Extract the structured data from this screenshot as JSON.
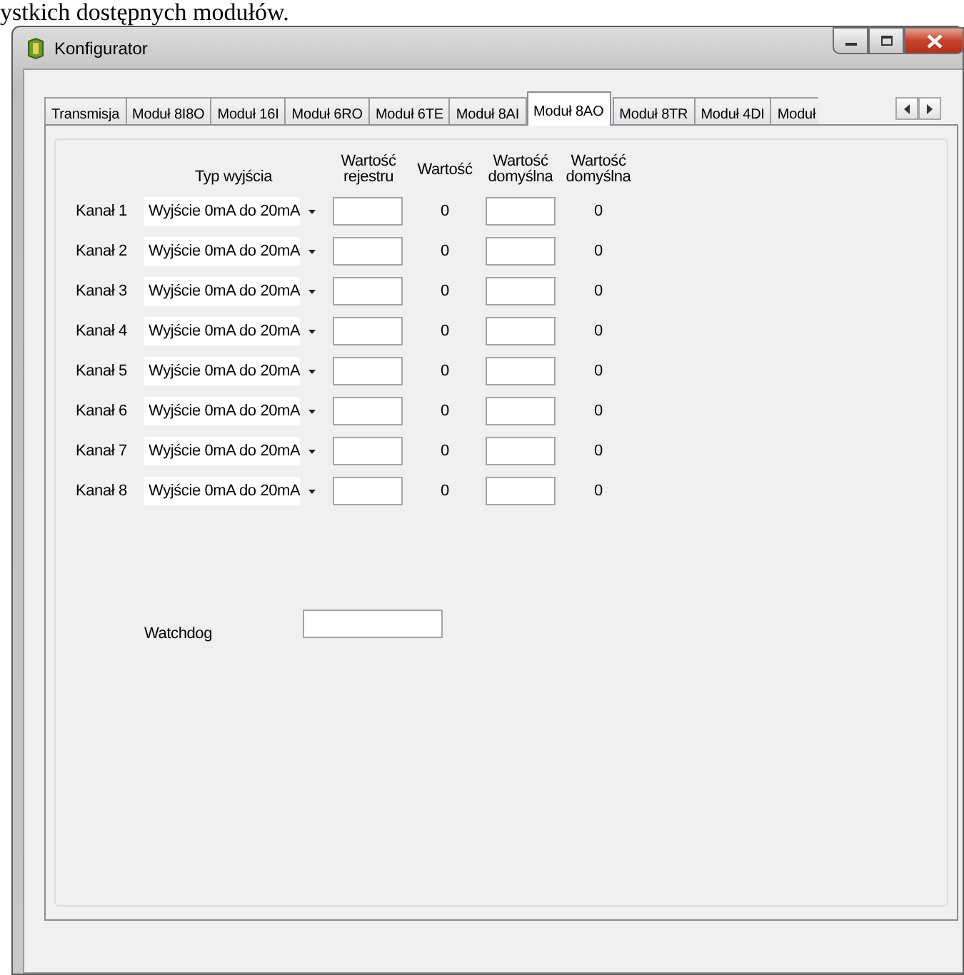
{
  "document_text": "ystkich dostępnych modułów.",
  "window": {
    "title": "Konfigurator"
  },
  "tabs": [
    {
      "label": "Transmisja",
      "selected": false
    },
    {
      "label": "Moduł 8I8O",
      "selected": false
    },
    {
      "label": "Moduł 16I",
      "selected": false
    },
    {
      "label": "Moduł 6RO",
      "selected": false
    },
    {
      "label": "Moduł 6TE",
      "selected": false
    },
    {
      "label": "Moduł 8AI",
      "selected": false
    },
    {
      "label": "Moduł 8AO",
      "selected": true
    },
    {
      "label": "Moduł 8TR",
      "selected": false
    },
    {
      "label": "Moduł 4DI",
      "selected": false
    },
    {
      "label": "Moduł",
      "selected": false
    }
  ],
  "columns": [
    "Typ wyjścia",
    "Wartość rejestru",
    "Wartość",
    "Wartość domyślna",
    "Wartość domyślna"
  ],
  "channels": [
    {
      "label": "Kanał 1",
      "output_type": "Wyjście 0mA do 20mA",
      "value": "0",
      "default_value": "0"
    },
    {
      "label": "Kanał 2",
      "output_type": "Wyjście 0mA do 20mA",
      "value": "0",
      "default_value": "0"
    },
    {
      "label": "Kanał 3",
      "output_type": "Wyjście 0mA do 20mA",
      "value": "0",
      "default_value": "0"
    },
    {
      "label": "Kanał 4",
      "output_type": "Wyjście 0mA do 20mA",
      "value": "0",
      "default_value": "0"
    },
    {
      "label": "Kanał 5",
      "output_type": "Wyjście 0mA do 20mA",
      "value": "0",
      "default_value": "0"
    },
    {
      "label": "Kanał 6",
      "output_type": "Wyjście 0mA do 20mA",
      "value": "0",
      "default_value": "0"
    },
    {
      "label": "Kanał 7",
      "output_type": "Wyjście 0mA do 20mA",
      "value": "0",
      "default_value": "0"
    },
    {
      "label": "Kanał 8",
      "output_type": "Wyjście 0mA do 20mA",
      "value": "0",
      "default_value": "0"
    }
  ],
  "watchdog": {
    "label": "Watchdog"
  }
}
